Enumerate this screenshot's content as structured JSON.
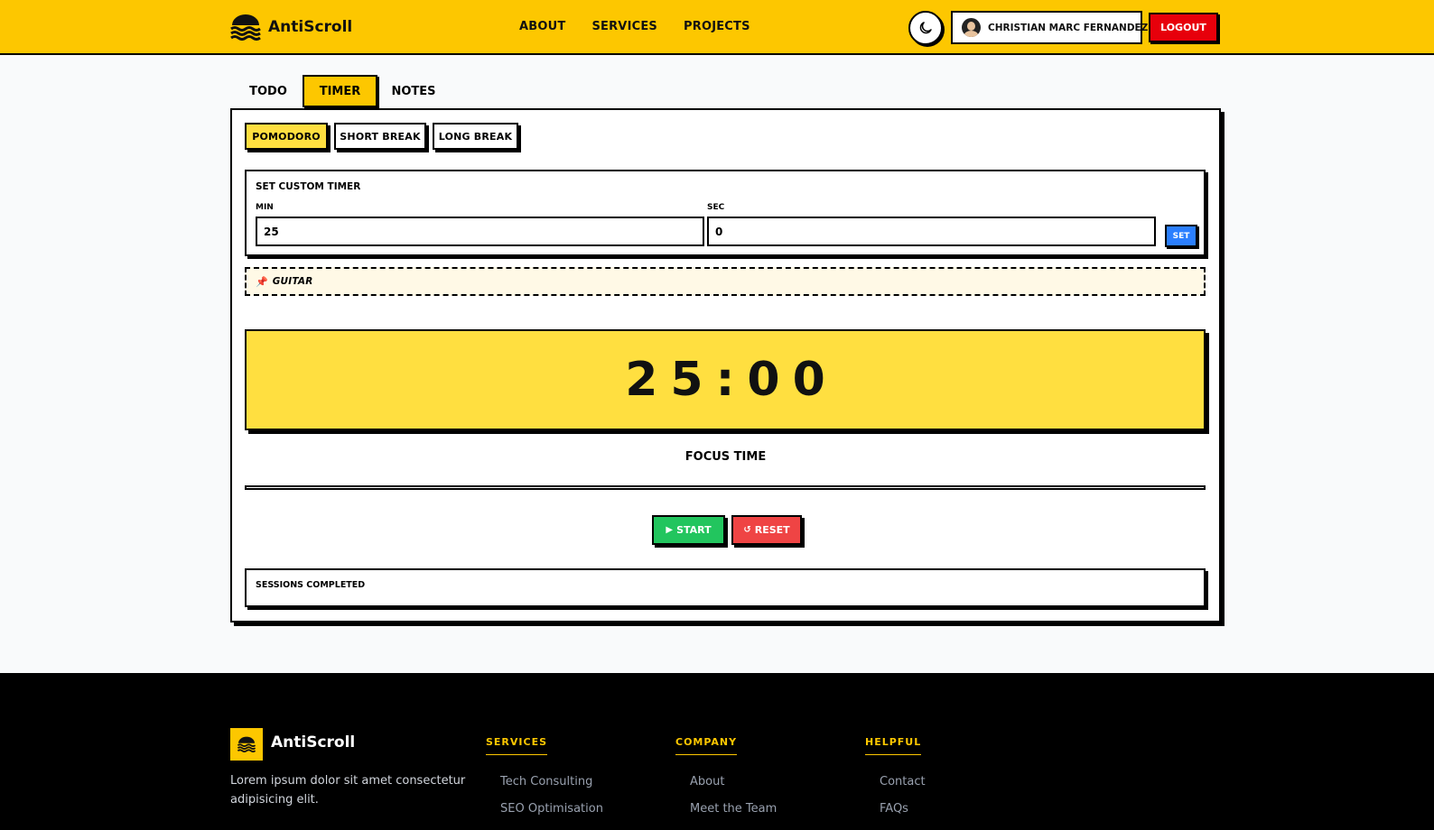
{
  "brand": {
    "name": "AntiScroll",
    "logo_icon": "wave-logo-icon"
  },
  "nav": {
    "links": [
      "ABOUT",
      "SERVICES",
      "PROJECTS"
    ],
    "theme_toggle_icon": "moon-icon",
    "user_name": "CHRISTIAN MARC FERNANDEZ",
    "logout_label": "LOGOUT"
  },
  "tabs": {
    "todo": "TODO",
    "timer": "TIMER",
    "notes": "NOTES",
    "active": "TIMER"
  },
  "timer": {
    "modes": {
      "pomodoro": "POMODORO",
      "short_break": "SHORT BREAK",
      "long_break": "LONG BREAK",
      "active": "POMODORO"
    },
    "custom": {
      "title": "SET CUSTOM TIMER",
      "min_label": "MIN",
      "sec_label": "SEC",
      "min_value": "25",
      "sec_value": "0",
      "set_label": "SET"
    },
    "pinned_task": {
      "icon": "pin-icon",
      "text": "GUITAR"
    },
    "display": "25:00",
    "status": "FOCUS TIME",
    "progress": 0,
    "start_label": "START",
    "start_icon": "play-icon",
    "reset_label": "RESET",
    "reset_icon": "reset-icon",
    "sessions_label": "SESSIONS COMPLETED"
  },
  "footer": {
    "brand": "AntiScroll",
    "description": "Lorem ipsum dolor sit amet consectetur adipisicing elit.",
    "columns": [
      {
        "heading": "SERVICES",
        "links": [
          "Tech Consulting",
          "SEO Optimisation"
        ]
      },
      {
        "heading": "COMPANY",
        "links": [
          "About",
          "Meet the Team"
        ]
      },
      {
        "heading": "HELPFUL",
        "links": [
          "Contact",
          "FAQs"
        ]
      }
    ]
  },
  "colors": {
    "primary_yellow": "#fdc700",
    "timer_yellow": "#ffdf40",
    "logout_red": "#e7000b",
    "start_green": "#22c55e",
    "reset_red": "#ef4444",
    "set_blue": "#2b7fff",
    "footer_bg": "#000000"
  }
}
